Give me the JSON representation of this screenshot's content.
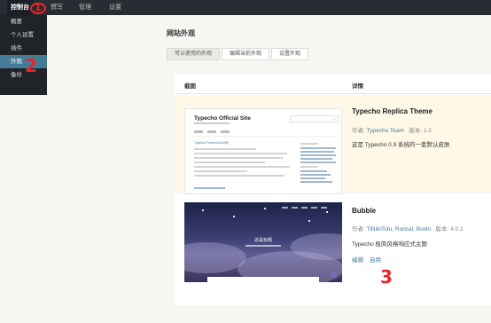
{
  "topbar": {
    "items": [
      "控制台",
      "撰写",
      "管理",
      "设置"
    ]
  },
  "dropdown": {
    "items": [
      "概要",
      "个人设置",
      "插件",
      "外观",
      "备份"
    ]
  },
  "page_title": "网站外观",
  "tabs": [
    "可以使用的外观",
    "编辑当前外观",
    "设置外观"
  ],
  "table": {
    "col_screenshot": "截图",
    "col_detail": "详情"
  },
  "themes": [
    {
      "name": "Typecho Replica Theme",
      "author_label": "作者:",
      "author": "Typecho Team",
      "version_label": "版本:",
      "version": "1.2",
      "description": "这是 Typecho 0.9 系统的一套默认皮肤",
      "preview": {
        "site_title": "Typecho Official Site",
        "post_title": "Typecho Framework示例"
      }
    },
    {
      "name": "Bubble",
      "author_label": "作者:",
      "author": "TiNibiTofu, Rorical, Boshi",
      "version_label": "版本:",
      "version": "4.0.2",
      "description": "Typecho 极简风格响应式主题",
      "actions": [
        "编辑",
        "启用"
      ],
      "preview": {
        "site_title": "这是标题"
      }
    }
  ],
  "annotations": [
    "1",
    "2",
    "3"
  ],
  "colors": {
    "topbar": "#292d33",
    "accent": "#467b96",
    "highlight_row": "#fff8e7",
    "annotation": "#e8262b"
  }
}
